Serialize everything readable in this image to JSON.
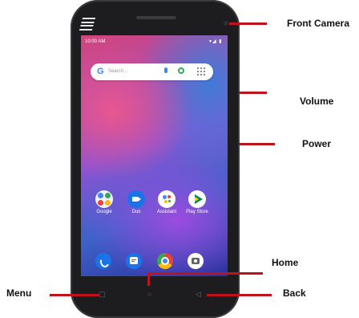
{
  "status_bar": {
    "time": "10:00 AM",
    "icons": "▾◢ ▮"
  },
  "search": {
    "g_letter": "G",
    "placeholder": "Search..."
  },
  "apps": [
    {
      "label": "Google"
    },
    {
      "label": "Duo"
    },
    {
      "label": "Assistant"
    },
    {
      "label": "Play Store"
    }
  ],
  "dock": [
    "Phone",
    "Messages",
    "Chrome",
    "Camera"
  ],
  "nav": {
    "menu_glyph": "▢",
    "home_glyph": "○",
    "back_glyph": "◁"
  },
  "callouts": {
    "front_camera": "Front Camera",
    "volume": "Volume",
    "power": "Power",
    "home": "Home",
    "menu": "Menu",
    "back": "Back"
  },
  "colors": {
    "callout_line": "#c0121c",
    "phone_body": "#1d1d1f"
  }
}
